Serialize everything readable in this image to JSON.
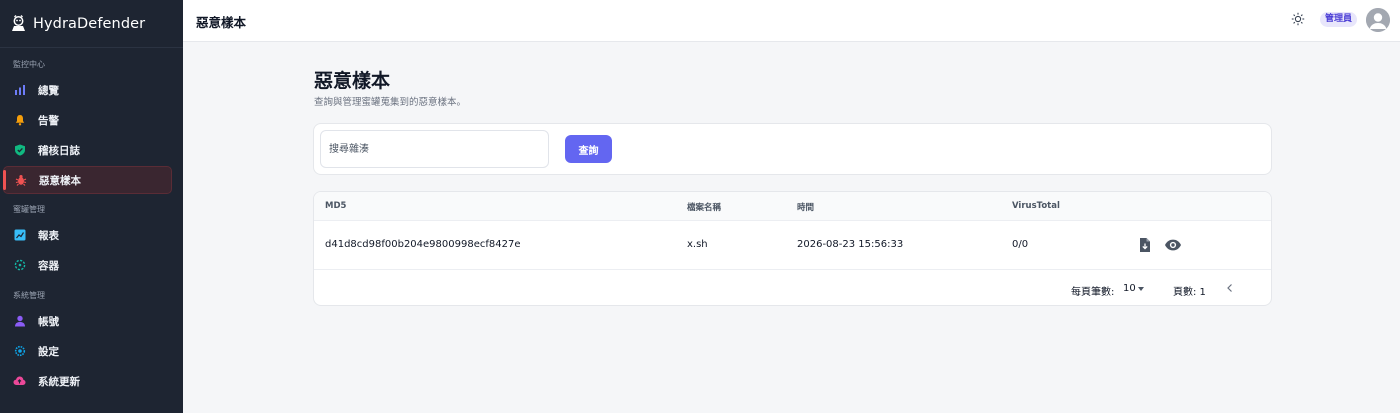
{
  "app": {
    "name": "HydraDefender"
  },
  "sidebar": {
    "sections": [
      {
        "title": "監控中心",
        "items": [
          {
            "label": "總覽",
            "icon": "bar-chart-icon"
          },
          {
            "label": "告警",
            "icon": "bell-icon"
          },
          {
            "label": "稽核日誌",
            "icon": "shield-check-icon"
          },
          {
            "label": "惡意樣本",
            "icon": "bug-icon",
            "active": true
          }
        ]
      },
      {
        "title": "蜜罐管理",
        "items": [
          {
            "label": "報表",
            "icon": "chart-report-icon"
          },
          {
            "label": "容器",
            "icon": "container-icon"
          }
        ]
      },
      {
        "title": "系統管理",
        "items": [
          {
            "label": "帳號",
            "icon": "user-icon"
          },
          {
            "label": "設定",
            "icon": "settings-icon"
          },
          {
            "label": "系統更新",
            "icon": "cloud-upload-icon"
          }
        ]
      }
    ]
  },
  "topbar": {
    "title": "惡意樣本",
    "role_badge": "管理員"
  },
  "page": {
    "title": "惡意樣本",
    "description": "查詢與管理蜜罐蒐集到的惡意樣本。"
  },
  "search": {
    "placeholder": "搜尋雜湊",
    "button_label": "查詢"
  },
  "table": {
    "columns": [
      "MD5",
      "檔案名稱",
      "時間",
      "VirusTotal"
    ],
    "rows": [
      {
        "md5": "d41d8cd98f00b204e9800998ecf8427e",
        "filename": "x.sh",
        "time": "2026-08-23 15:56:33",
        "virustotal": "0/0"
      }
    ],
    "pagination": {
      "rows_per_page_label": "每頁筆數:",
      "rows_per_page": "10",
      "page_label": "頁數: 1"
    }
  },
  "colors": {
    "sidebar_bg": "#1e2532",
    "accent": "#6366f1",
    "active_marker": "#f05252"
  }
}
